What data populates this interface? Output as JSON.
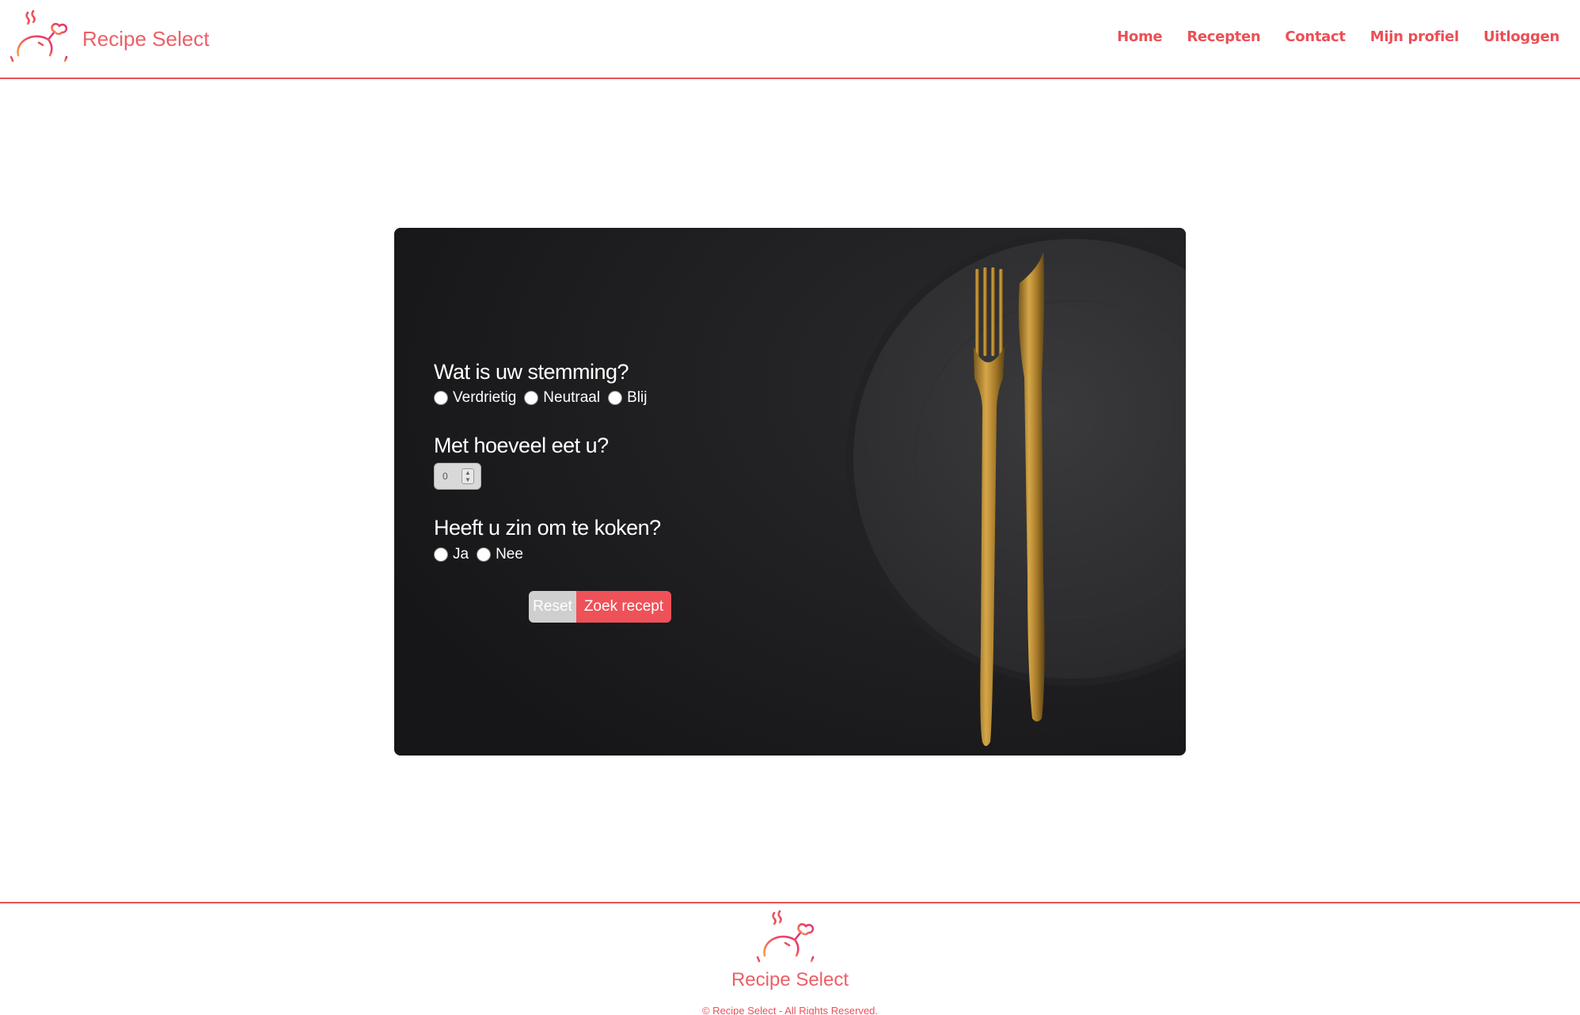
{
  "header": {
    "brand_name": "Recipe Select",
    "nav": [
      "Home",
      "Recepten",
      "Contact",
      "Mijn profiel",
      "Uitloggen"
    ]
  },
  "form": {
    "mood_question": "Wat is uw stemming?",
    "mood_options": [
      "Verdrietig",
      "Neutraal",
      "Blij"
    ],
    "people_question": "Met hoeveel eet u?",
    "people_value": "0",
    "cook_question": "Heeft u zin om te koken?",
    "cook_options": [
      "Ja",
      "Nee"
    ],
    "reset_label": "Reset",
    "search_label": "Zoek recept"
  },
  "footer": {
    "brand_name": "Recipe Select",
    "copyright": "© Recipe Select - All Rights Reserved."
  },
  "colors": {
    "accent": "#ef5158",
    "card_bg": "#1c1c1e",
    "reset_bg": "#cfcfcf"
  },
  "icons": {
    "logo": "roast-chicken-icon"
  }
}
